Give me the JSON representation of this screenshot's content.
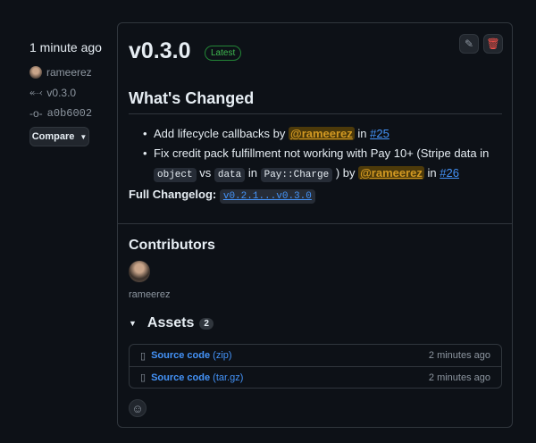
{
  "sidebar": {
    "time": "1 minute ago",
    "author": "rameerez",
    "tag": "v0.3.0",
    "commit": "a0b6002",
    "compare_label": "Compare"
  },
  "release": {
    "title": "v0.3.0",
    "badge": "Latest",
    "heading": "What's Changed",
    "items": [
      {
        "text": "Add lifecycle callbacks by ",
        "mention": "@rameerez",
        "in": " in ",
        "pr": "#25"
      },
      {
        "text": "Fix credit pack fulfillment not working with Pay 10+ (Stripe data in ",
        "code1": "object",
        "vs": " vs ",
        "code2": "data",
        "in1": " in ",
        "code3": "Pay::Charge",
        "by": " ) by ",
        "mention": "@rameerez",
        "in": " in ",
        "pr": "#26"
      }
    ],
    "changelog_label": "Full Changelog:",
    "changelog_link": "v0.2.1...v0.3.0"
  },
  "contributors": {
    "heading": "Contributors",
    "names": [
      "rameerez"
    ]
  },
  "assets": {
    "heading": "Assets",
    "count": "2",
    "rows": [
      {
        "name": "Source code",
        "ext": "(zip)",
        "time": "2 minutes ago"
      },
      {
        "name": "Source code",
        "ext": "(tar.gz)",
        "time": "2 minutes ago"
      }
    ]
  }
}
